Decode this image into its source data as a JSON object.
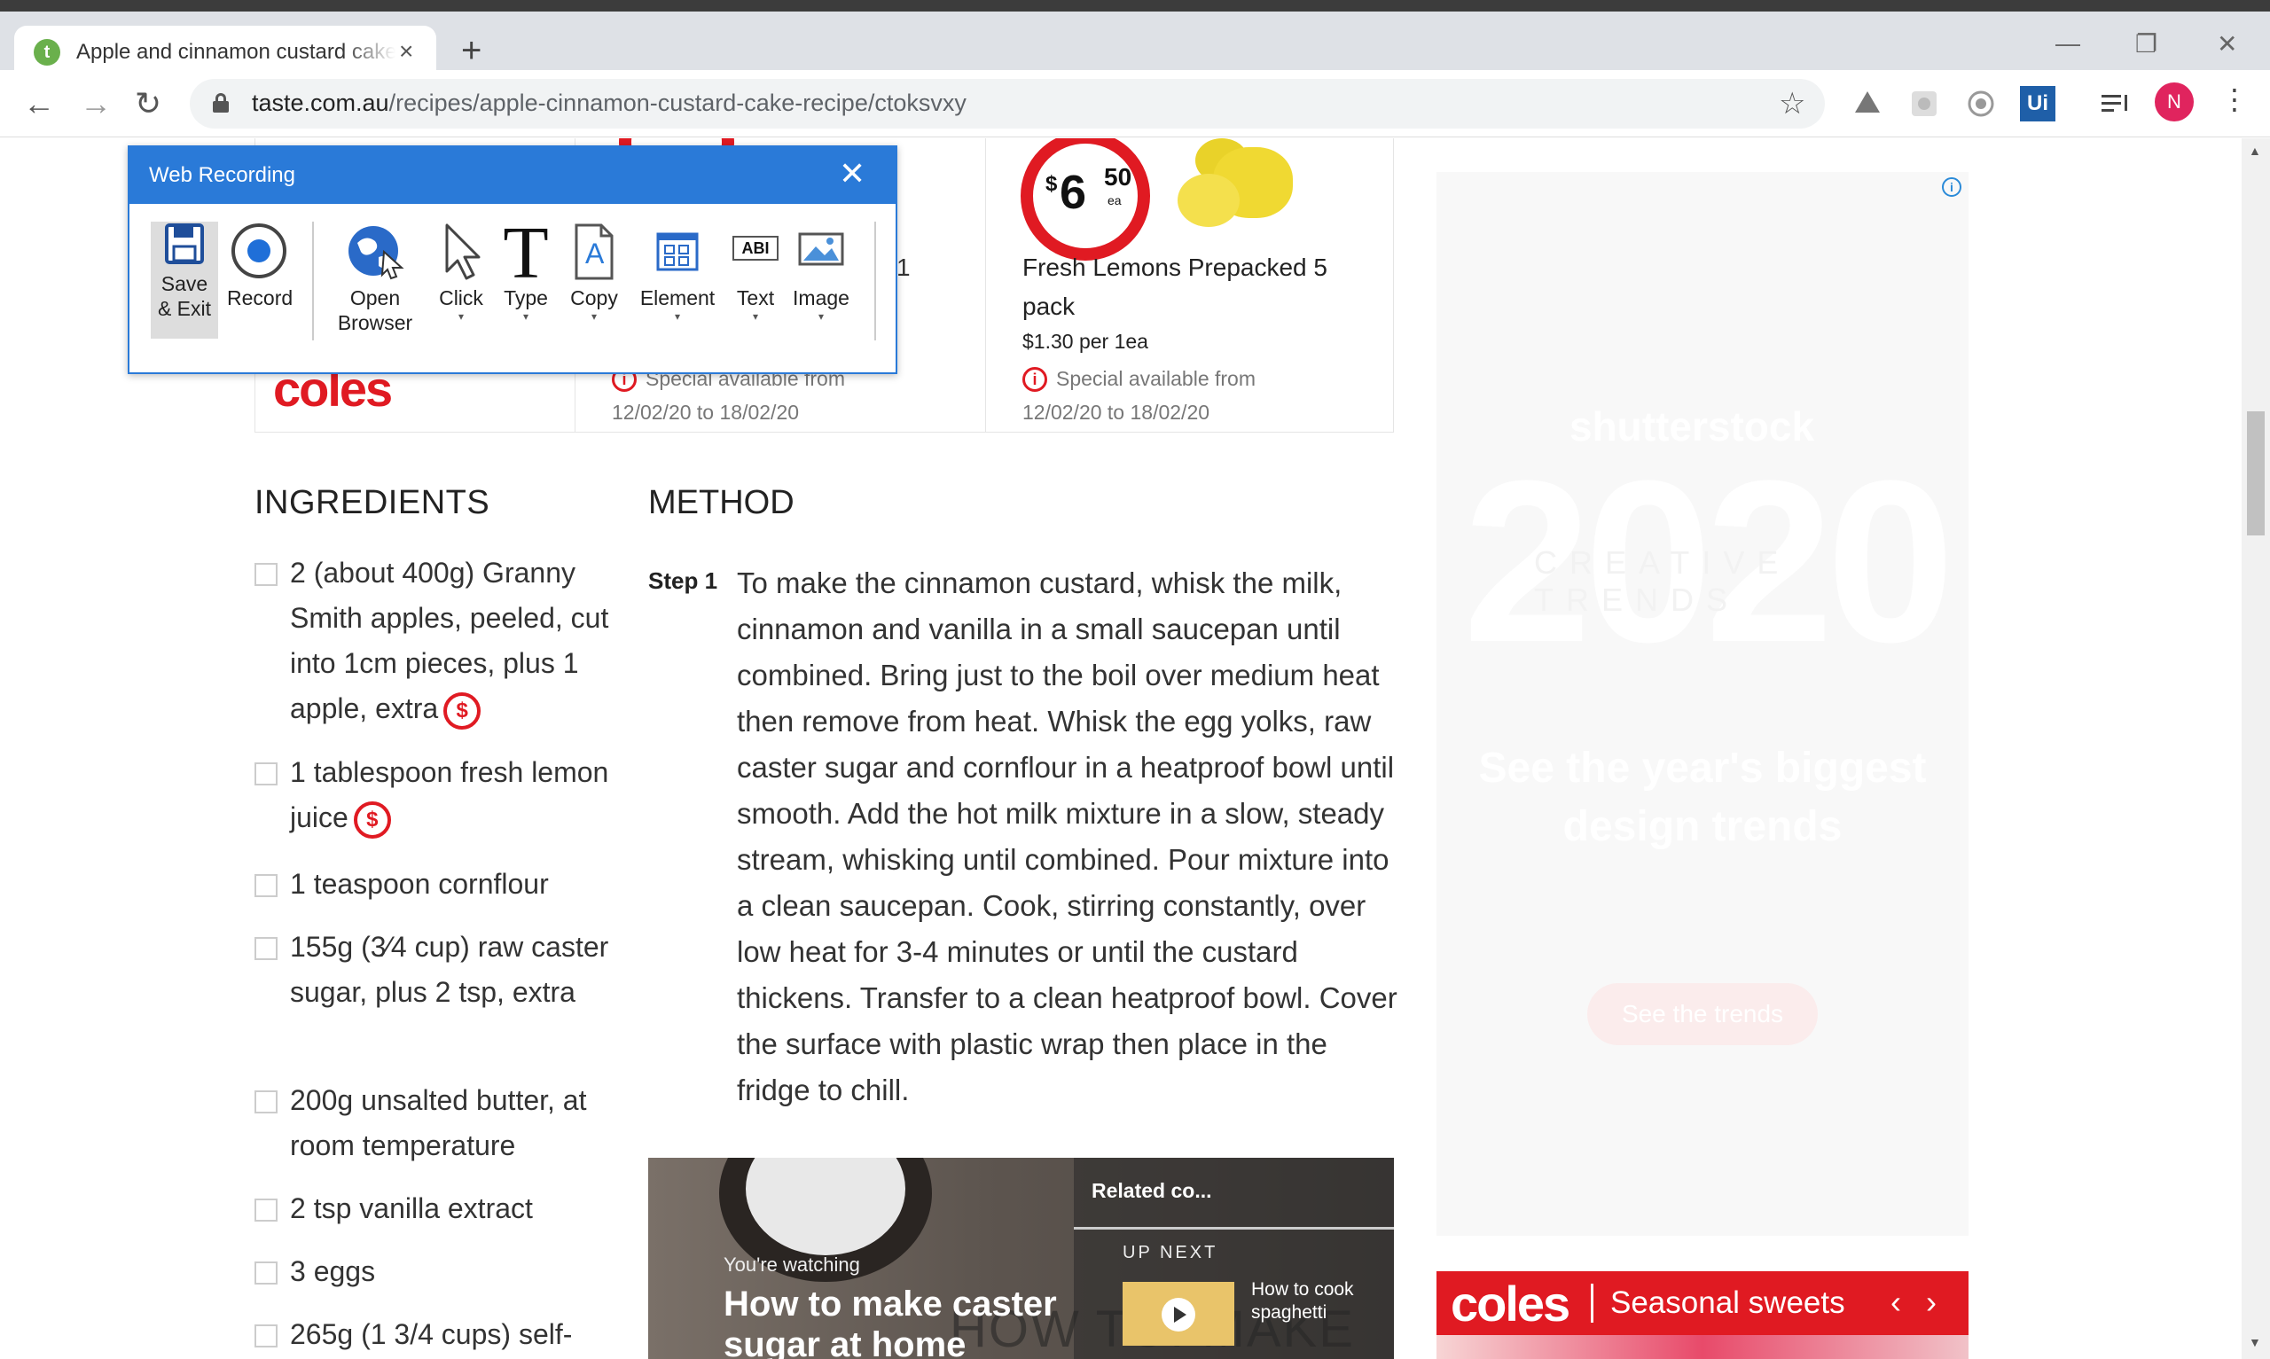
{
  "browser": {
    "tab_title": "Apple and cinnamon custard cake recipe",
    "tab_close": "×",
    "new_tab": "+",
    "window_controls": [
      "—",
      "❐",
      "✕"
    ],
    "nav": {
      "back": "←",
      "forward": "→",
      "reload": "↻"
    },
    "url_domain": "taste.com.au",
    "url_path": "/recipes/apple-cinnamon-custard-cake-recipe/ctoksvxy",
    "star": "☆",
    "avatar_letter": "N",
    "menu": "⋮",
    "extensions": [
      "drive-icon",
      "extension-icon",
      "record-icon",
      "uipath-icon",
      "playlist-icon"
    ],
    "uipath_label": "Ui"
  },
  "recorder": {
    "title": "Web Recording",
    "close": "✕",
    "buttons": [
      {
        "label": "Save\n& Exit"
      },
      {
        "label": "Record"
      },
      {
        "label": "Open\nBrowser"
      },
      {
        "label": "Click"
      },
      {
        "label": "Type"
      },
      {
        "label": "Copy"
      },
      {
        "label": "Element"
      },
      {
        "label": "Text"
      },
      {
        "label": "Image"
      }
    ],
    "type_glyph": "T",
    "copy_glyph": "A",
    "text_glyph": "ABI",
    "caret": "▾"
  },
  "products": {
    "brand": "coles",
    "partial_name_fragment": "1",
    "left_special": "Special available from",
    "left_dates": "12/02/20 to 18/02/20",
    "price_dollar": "$",
    "price_main": "6",
    "price_cents": "50",
    "price_unit": "ea",
    "name": "Fresh Lemons Prepacked 5 pack",
    "unit_price": "$1.30 per 1ea",
    "special": "Special available from",
    "dates": "12/02/20 to 18/02/20",
    "special_icon": "i"
  },
  "ingredients": {
    "title": "INGREDIENTS",
    "dollar_glyph": "$",
    "items": [
      {
        "text": "2 (about 400g) Granny Smith apples, peeled, cut into 1cm pieces, plus 1 apple, extra"
      },
      {
        "text": "1 tablespoon fresh lemon juice"
      },
      {
        "text": "1 teaspoon cornflour"
      },
      {
        "text": "155g (3⁄4 cup) raw caster sugar, plus 2 tsp, extra"
      },
      {
        "text": "200g unsalted butter, at room temperature"
      },
      {
        "text": "2 tsp vanilla extract"
      },
      {
        "text": "3 eggs"
      },
      {
        "text": "265g (1 3/4 cups) self-"
      }
    ]
  },
  "method": {
    "title": "METHOD",
    "step_label": "Step 1",
    "step_text": "To make the cinnamon custard, whisk the milk, cinnamon and vanilla in a small saucepan until combined. Bring just to the boil over medium heat then remove from heat. Whisk the egg yolks, raw caster sugar and cornflour in a heatproof bowl until smooth. Add the hot milk mixture in a slow, steady stream, whisking until combined. Pour mixture into a clean saucepan. Cook, stirring constantly, over low heat for 3-4 minutes or until the custard thickens. Transfer to a clean heatproof bowl. Cover the surface with plastic wrap then place in the fridge to chill."
  },
  "video": {
    "watching": "You're watching",
    "title": "How to make caster sugar at home",
    "bg_text": "HOW TO: MAKE",
    "related": "Related co...",
    "up_next": "UP NEXT",
    "next_title": "How to cook spaghetti"
  },
  "ad": {
    "info": "i",
    "brand": "shutterstock",
    "year": "2020",
    "trends": "CREATIVE TRENDS",
    "tagline": "See the year's biggest design trends",
    "cta": "See the trends"
  },
  "coles_banner": {
    "logo": "coles",
    "text": "Seasonal sweets",
    "prev": "‹",
    "next": "›"
  },
  "scroll": {
    "up": "▲",
    "down": "▼"
  }
}
